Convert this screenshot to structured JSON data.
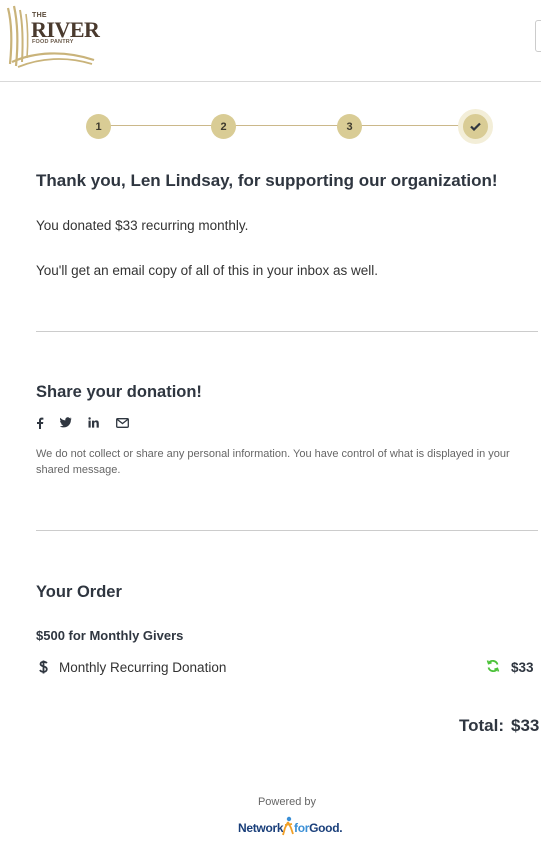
{
  "header": {
    "logo": {
      "line1": "THE",
      "line2": "RIVER",
      "line3": "FOOD PANTRY"
    }
  },
  "progress": {
    "steps": [
      {
        "label": "1",
        "status": "complete"
      },
      {
        "label": "2",
        "status": "complete"
      },
      {
        "label": "3",
        "status": "complete"
      },
      {
        "label": "",
        "status": "done",
        "icon": "check-icon"
      }
    ],
    "accent_color": "#d9cc95",
    "line_color": "#cbb88a"
  },
  "confirmation": {
    "heading": "Thank you, Len Lindsay, for supporting our organization!",
    "donation_text": "You donated $33 recurring monthly.",
    "email_text": "You'll get an email copy of all of this in your inbox as well."
  },
  "share": {
    "heading": "Share your donation!",
    "icons": [
      "facebook-icon",
      "twitter-icon",
      "linkedin-icon",
      "email-icon"
    ],
    "privacy_note": "We do not collect or share any personal information. You have control of what is displayed in your shared message."
  },
  "order": {
    "heading": "Your Order",
    "item_title": "$500 for Monthly Givers",
    "line_label": "Monthly Recurring Donation",
    "line_amount": "$33",
    "recurring_icon_color": "#4cc23a",
    "total_label": "Total:",
    "total_amount": "$33"
  },
  "footer": {
    "powered_by": "Powered by",
    "brand": {
      "part1": "Network",
      "part2": "for",
      "part3": "Good."
    }
  }
}
